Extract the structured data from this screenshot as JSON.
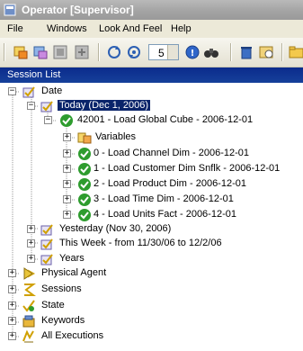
{
  "window": {
    "title": "Operator [Supervisor]"
  },
  "menu": [
    "File",
    "Windows",
    "Look And Feel",
    "Help"
  ],
  "toolbar": {
    "spinner_value": "5"
  },
  "panel": {
    "title": "Session List"
  },
  "tree": {
    "date": "Date",
    "today": "Today (Dec 1, 2006)",
    "session": "42001 - Load Global Cube - 2006-12-01",
    "variables": "Variables",
    "steps": [
      "0 - Load Channel Dim - 2006-12-01",
      "1 - Load Customer Dim Snflk - 2006-12-01",
      "2 - Load Product Dim - 2006-12-01",
      "3 - Load Time Dim - 2006-12-01",
      "4 - Load Units Fact - 2006-12-01"
    ],
    "yesterday": "Yesterday (Nov 30, 2006)",
    "this_week": "This Week - from 11/30/06 to 12/2/06",
    "years": "Years",
    "physical_agent": "Physical Agent",
    "sessions": "Sessions",
    "state": "State",
    "keywords": "Keywords",
    "all_executions": "All Executions"
  },
  "colors": {
    "selection": "#0a246a",
    "panel_header": "#0b2b8c",
    "status_ok": "#2e9c2e"
  },
  "icons": {
    "date_node": "calendar-check-icon",
    "step_status": "green-check-icon",
    "variables": "variables-icon",
    "physical_agent": "agent-icon",
    "sessions": "sessions-icon",
    "state": "state-icon",
    "keywords": "keywords-icon",
    "all_executions": "executions-icon"
  }
}
